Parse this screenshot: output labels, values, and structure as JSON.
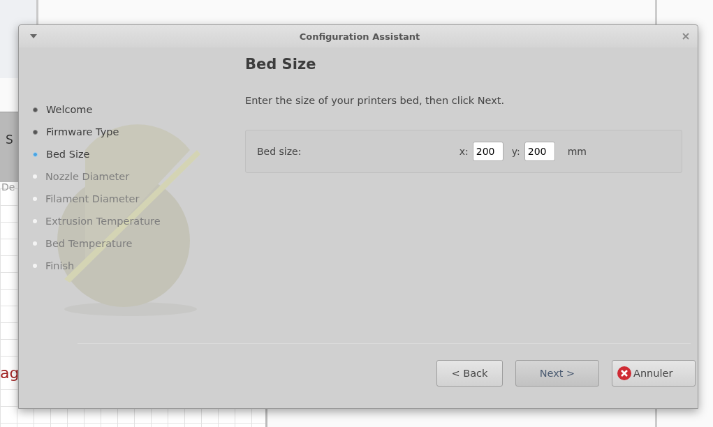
{
  "background_window": {
    "fragments": [
      "S",
      "De",
      "ag"
    ]
  },
  "dialog": {
    "title": "Configuration Assistant"
  },
  "steps": [
    {
      "label": "Welcome",
      "completed": true,
      "selected": false
    },
    {
      "label": "Firmware Type",
      "completed": true,
      "selected": false
    },
    {
      "label": "Bed Size",
      "completed": false,
      "selected": true
    },
    {
      "label": "Nozzle Diameter",
      "completed": false,
      "selected": false
    },
    {
      "label": "Filament Diameter",
      "completed": false,
      "selected": false
    },
    {
      "label": "Extrusion Temperature",
      "completed": false,
      "selected": false
    },
    {
      "label": "Bed Temperature",
      "completed": false,
      "selected": false
    },
    {
      "label": "Finish",
      "completed": false,
      "selected": false
    }
  ],
  "page": {
    "heading": "Bed Size",
    "description": "Enter the size of your printers bed, then click Next.",
    "field_label": "Bed size:",
    "x_label": "x:",
    "x_value": "200",
    "y_label": "y:",
    "y_value": "200",
    "unit": "mm"
  },
  "buttons": [
    {
      "label": "< Back",
      "kind": "plain"
    },
    {
      "label": "Next >",
      "kind": "default"
    },
    {
      "label": "Annuler",
      "kind": "cancel"
    }
  ]
}
